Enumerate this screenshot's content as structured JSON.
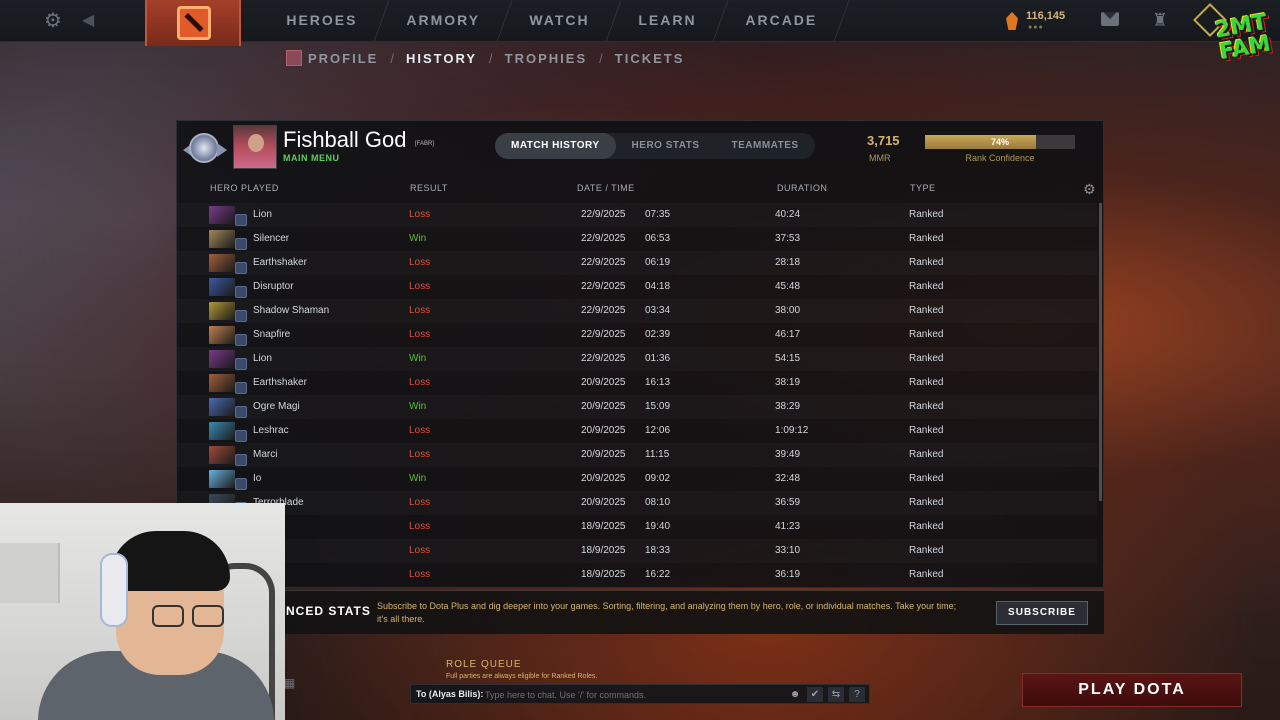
{
  "nav": {
    "items": [
      "HEROES",
      "ARMORY",
      "WATCH",
      "LEARN",
      "ARCADE"
    ],
    "currency": "116,145",
    "brand_logo_text": "2MT FAM"
  },
  "subnav": {
    "items": [
      "PROFILE",
      "HISTORY",
      "TROPHIES",
      "TICKETS"
    ],
    "active": "HISTORY"
  },
  "profile": {
    "name": "Fishball God",
    "tag": "[FABR]",
    "status": "MAIN MENU"
  },
  "tabs": {
    "match_history": "MATCH HISTORY",
    "hero_stats": "HERO STATS",
    "teammates": "TEAMMATES"
  },
  "mmr": {
    "value": "3,715",
    "label": "MMR",
    "confidence_pct": "74%",
    "confidence_fraction": 0.74,
    "confidence_label": "Rank Confidence"
  },
  "table": {
    "headers": {
      "hero": "HERO PLAYED",
      "result": "RESULT",
      "datetime": "DATE / TIME",
      "duration": "DURATION",
      "type": "TYPE"
    },
    "rows": [
      {
        "hero": "Lion",
        "result": "Loss",
        "date": "22/9/2025",
        "time": "07:35",
        "duration": "40:24",
        "type": "Ranked",
        "color": "#7a3a8a"
      },
      {
        "hero": "Silencer",
        "result": "Win",
        "date": "22/9/2025",
        "time": "06:53",
        "duration": "37:53",
        "type": "Ranked",
        "color": "#a08a5a"
      },
      {
        "hero": "Earthshaker",
        "result": "Loss",
        "date": "22/9/2025",
        "time": "06:19",
        "duration": "28:18",
        "type": "Ranked",
        "color": "#a0603a"
      },
      {
        "hero": "Disruptor",
        "result": "Loss",
        "date": "22/9/2025",
        "time": "04:18",
        "duration": "45:48",
        "type": "Ranked",
        "color": "#3a5aa0"
      },
      {
        "hero": "Shadow Shaman",
        "result": "Loss",
        "date": "22/9/2025",
        "time": "03:34",
        "duration": "38:00",
        "type": "Ranked",
        "color": "#b09a3a"
      },
      {
        "hero": "Snapfire",
        "result": "Loss",
        "date": "22/9/2025",
        "time": "02:39",
        "duration": "46:17",
        "type": "Ranked",
        "color": "#c08050"
      },
      {
        "hero": "Lion",
        "result": "Win",
        "date": "22/9/2025",
        "time": "01:36",
        "duration": "54:15",
        "type": "Ranked",
        "color": "#7a3a8a"
      },
      {
        "hero": "Earthshaker",
        "result": "Loss",
        "date": "20/9/2025",
        "time": "16:13",
        "duration": "38:19",
        "type": "Ranked",
        "color": "#a0603a"
      },
      {
        "hero": "Ogre Magi",
        "result": "Win",
        "date": "20/9/2025",
        "time": "15:09",
        "duration": "38:29",
        "type": "Ranked",
        "color": "#4a6ab0"
      },
      {
        "hero": "Leshrac",
        "result": "Loss",
        "date": "20/9/2025",
        "time": "12:06",
        "duration": "1:09:12",
        "type": "Ranked",
        "color": "#3a8ab0"
      },
      {
        "hero": "Marci",
        "result": "Loss",
        "date": "20/9/2025",
        "time": "11:15",
        "duration": "39:49",
        "type": "Ranked",
        "color": "#a04a3a"
      },
      {
        "hero": "Io",
        "result": "Win",
        "date": "20/9/2025",
        "time": "09:02",
        "duration": "32:48",
        "type": "Ranked",
        "color": "#6ab0e0"
      },
      {
        "hero": "Terrorblade",
        "result": "Loss",
        "date": "20/9/2025",
        "time": "08:10",
        "duration": "36:59",
        "type": "Ranked",
        "color": "#3a4a5a"
      },
      {
        "hero": "",
        "result": "Loss",
        "date": "18/9/2025",
        "time": "19:40",
        "duration": "41:23",
        "type": "Ranked",
        "color": ""
      },
      {
        "hero": "",
        "result": "Loss",
        "date": "18/9/2025",
        "time": "18:33",
        "duration": "33:10",
        "type": "Ranked",
        "color": ""
      },
      {
        "hero": "",
        "result": "Loss",
        "date": "18/9/2025",
        "time": "16:22",
        "duration": "36:19",
        "type": "Ranked",
        "color": ""
      }
    ]
  },
  "dota_plus": {
    "title": "NCED STATS",
    "text": "Subscribe to Dota Plus and dig deeper into your games. Sorting, filtering, and analyzing them by hero, role, or individual matches. Take your time; it's all there.",
    "button": "SUBSCRIBE"
  },
  "role_queue": {
    "title": "ROLE QUEUE",
    "subtitle": "Full parties are always eligible for Ranked Roles."
  },
  "chat": {
    "to": "To (Alyas Bilis):",
    "placeholder": "Type here to chat. Use '/' for commands."
  },
  "play_button": "PLAY DOTA",
  "colors": {
    "loss": "#d9513f",
    "win": "#56c12f",
    "gold": "#d8b46a"
  }
}
